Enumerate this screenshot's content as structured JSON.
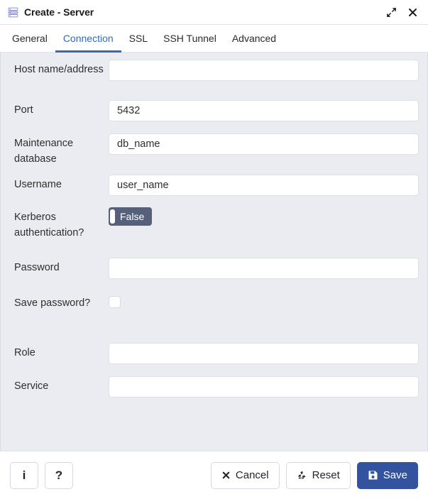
{
  "window": {
    "title": "Create - Server",
    "icon": "database-icon",
    "controls": [
      {
        "name": "maximize-icon",
        "label": "Maximize"
      },
      {
        "name": "close-icon",
        "label": "Close"
      }
    ]
  },
  "tabs": [
    {
      "label": "General",
      "active": false
    },
    {
      "label": "Connection",
      "active": true
    },
    {
      "label": "SSL",
      "active": false
    },
    {
      "label": "SSH Tunnel",
      "active": false
    },
    {
      "label": "Advanced",
      "active": false
    }
  ],
  "form": {
    "host": {
      "label": "Host name/address",
      "value": "",
      "placeholder": ""
    },
    "port": {
      "label": "Port",
      "value": "5432",
      "placeholder": ""
    },
    "maintenance_database": {
      "label": "Maintenance database",
      "value": "db_name",
      "placeholder": ""
    },
    "username": {
      "label": "Username",
      "value": "user_name",
      "placeholder": ""
    },
    "kerberos": {
      "label": "Kerberos authentication?",
      "state_label": "False",
      "checked": false
    },
    "password": {
      "label": "Password",
      "value": "",
      "placeholder": ""
    },
    "save_password": {
      "label": "Save password?",
      "checked": false
    },
    "role": {
      "label": "Role",
      "value": "",
      "placeholder": ""
    },
    "service": {
      "label": "Service",
      "value": "",
      "placeholder": ""
    }
  },
  "footer": {
    "info_label": "i",
    "help_label": "?",
    "cancel_label": "Cancel",
    "reset_label": "Reset",
    "save_label": "Save"
  },
  "colors": {
    "accent": "#326ab5",
    "primary_button": "#33539e",
    "form_background": "#eaecf1",
    "toggle_off": "#55607a",
    "icon_purple": "#9e9ed6"
  }
}
